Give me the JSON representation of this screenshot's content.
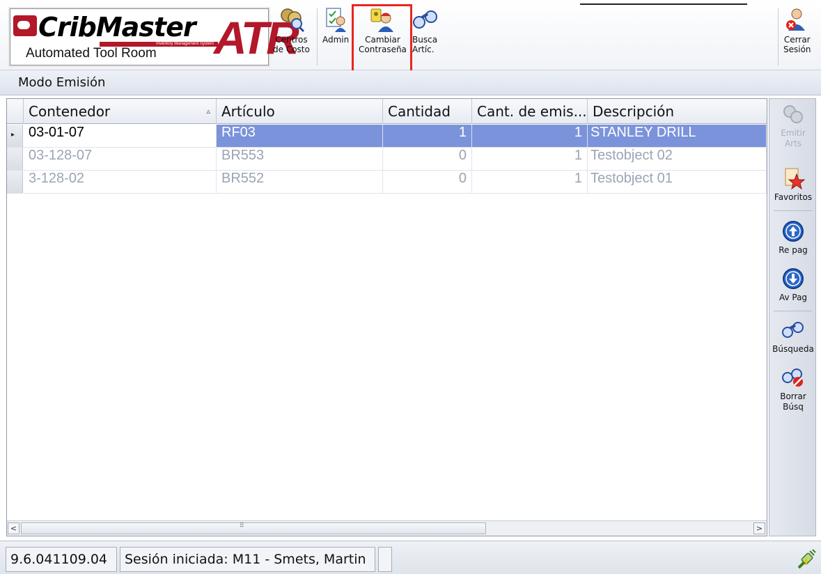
{
  "app": {
    "logo_main": "CribMaster",
    "logo_suffix": "ATR",
    "logo_subtitle": "Inventory Management System",
    "logo_tagline": "Automated Tool Room"
  },
  "toolbar": {
    "centros_label_1": "Centros",
    "centros_label_2": "de Costo",
    "admin_label": "Admin",
    "cambiar_label_1": "Cambiar",
    "cambiar_label_2": "Contraseña",
    "busca_label_1": "Busca",
    "busca_label_2": "Artíc.",
    "cerrar_label_1": "Cerrar",
    "cerrar_label_2": "Sesión"
  },
  "mode": {
    "title": "Modo Emisión"
  },
  "grid": {
    "columns": [
      "Contenedor",
      "Artículo",
      "Cantidad",
      "Cant. de emis...",
      "Descripción"
    ],
    "rows": [
      {
        "contenedor": "03-01-07",
        "articulo": "RF03",
        "cantidad": "1",
        "cant_emision": "1",
        "descripcion": "STANLEY DRILL"
      },
      {
        "contenedor": "03-128-07",
        "articulo": "BR553",
        "cantidad": "0",
        "cant_emision": "1",
        "descripcion": "Testobject 02"
      },
      {
        "contenedor": "3-128-02",
        "articulo": "BR552",
        "cantidad": "0",
        "cant_emision": "1",
        "descripcion": "Testobject 01"
      }
    ],
    "scroll_grip": "⠿",
    "scroll_left": "<",
    "scroll_right": ">"
  },
  "side": {
    "emitir_1": "Emitir",
    "emitir_2": "Arts",
    "favoritos": "Favoritos",
    "repag_1": "Re pag",
    "avpag": "Av Pag",
    "busqueda": "Búsqueda",
    "borrar_1": "Borrar",
    "borrar_2": "Búsq"
  },
  "status": {
    "version": "9.6.041109.04",
    "session": "Sesión iniciada: M11 - Smets, Martin"
  },
  "colors": {
    "selection": "#7b93da",
    "highlight_box": "#e8251f",
    "brand_red": "#b3172a"
  }
}
